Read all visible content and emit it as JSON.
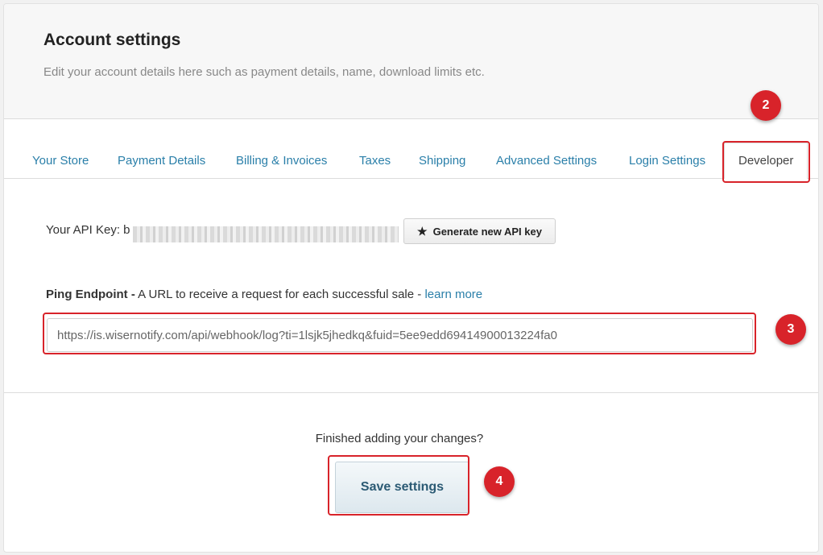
{
  "header": {
    "title": "Account settings",
    "subtitle": "Edit your account details here such as payment details, name, download limits etc."
  },
  "tabs": [
    {
      "label": "Your Store"
    },
    {
      "label": "Payment Details"
    },
    {
      "label": "Billing & Invoices"
    },
    {
      "label": "Taxes"
    },
    {
      "label": "Shipping"
    },
    {
      "label": "Advanced Settings"
    },
    {
      "label": "Login Settings"
    },
    {
      "label": "Developer",
      "active": true
    }
  ],
  "developer": {
    "api_key_label": "Your API Key: b",
    "generate_button_label": "Generate new API key",
    "generate_button_icon": "star-icon",
    "ping_label_bold": "Ping Endpoint -",
    "ping_label_text": " A URL to receive a request for each successful sale - ",
    "ping_learn_more": "learn more",
    "ping_url_value": "https://is.wisernotify.com/api/webhook/log?ti=1lsjk5jhedkq&fuid=5ee9edd69414900013224fa0"
  },
  "footer": {
    "prompt": "Finished adding your changes?",
    "save_button_label": "Save settings"
  },
  "annotations": {
    "marker_2": "2",
    "marker_3": "3",
    "marker_4": "4",
    "color": "#d8232a"
  },
  "colors": {
    "link": "#2a7fa9",
    "header_bg": "#f7f7f7"
  }
}
